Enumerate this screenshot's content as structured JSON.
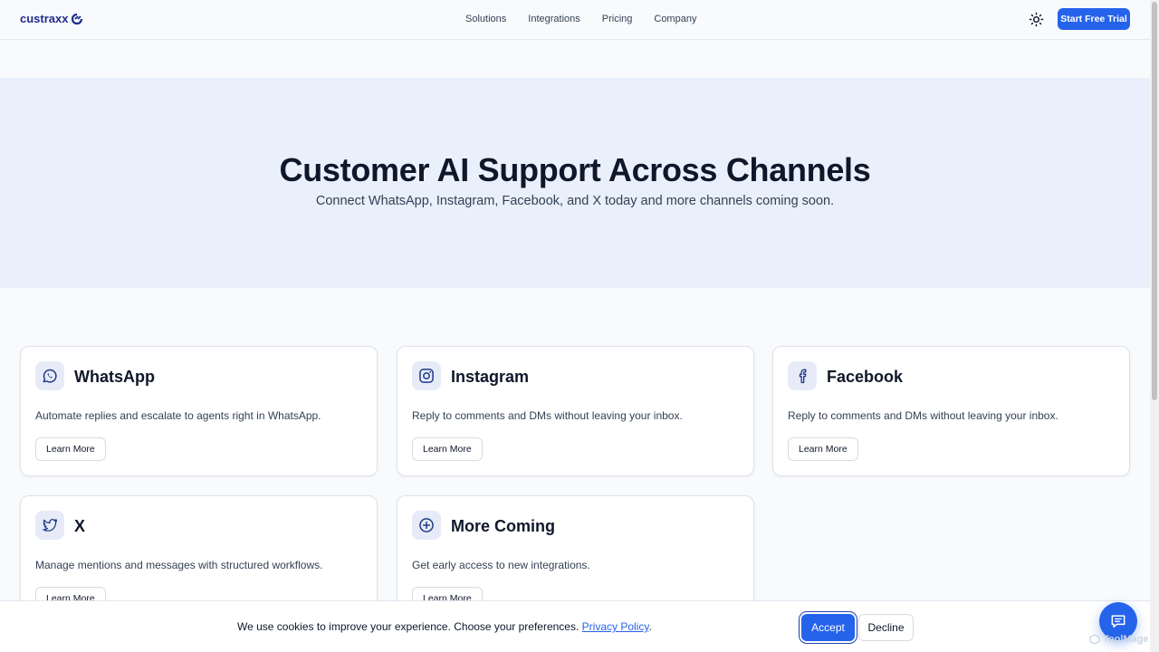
{
  "header": {
    "logo_text": "custraxx",
    "nav": [
      "Solutions",
      "Integrations",
      "Pricing",
      "Company"
    ],
    "theme_icon": "sun-icon",
    "cta_label": "Start Free Trial"
  },
  "hero": {
    "title": "Customer AI Support Across Channels",
    "subtitle": "Connect WhatsApp, Instagram, Facebook, and X today and more channels coming soon."
  },
  "channels": [
    {
      "title": "WhatsApp",
      "description": "Automate replies and escalate to agents right in WhatsApp.",
      "button": "Learn More",
      "icon": "whatsapp-icon"
    },
    {
      "title": "Instagram",
      "description": "Reply to comments and DMs without leaving your inbox.",
      "button": "Learn More",
      "icon": "instagram-icon"
    },
    {
      "title": "Facebook",
      "description": "Reply to comments and DMs without leaving your inbox.",
      "button": "Learn More",
      "icon": "facebook-icon"
    },
    {
      "title": "X",
      "description": "Manage mentions and messages with structured workflows.",
      "button": "Learn More",
      "icon": "twitter-icon"
    },
    {
      "title": "More Coming",
      "description": "Get early access to new integrations.",
      "button": "Learn More",
      "icon": "plus-circle-icon"
    }
  ],
  "cookie": {
    "message": "We use cookies to improve your experience. Choose your preferences.",
    "link": "Privacy Policy",
    "suffix": ".",
    "accept": "Accept",
    "decline": "Decline"
  },
  "chat": {
    "icon": "chat-icon"
  },
  "watermark": {
    "text": "ToolMage"
  },
  "colors": {
    "accent": "#2563eb",
    "hero_bg": "#eaf0fb",
    "page_bg": "#f8fafc",
    "logo": "#1e2b8f"
  }
}
